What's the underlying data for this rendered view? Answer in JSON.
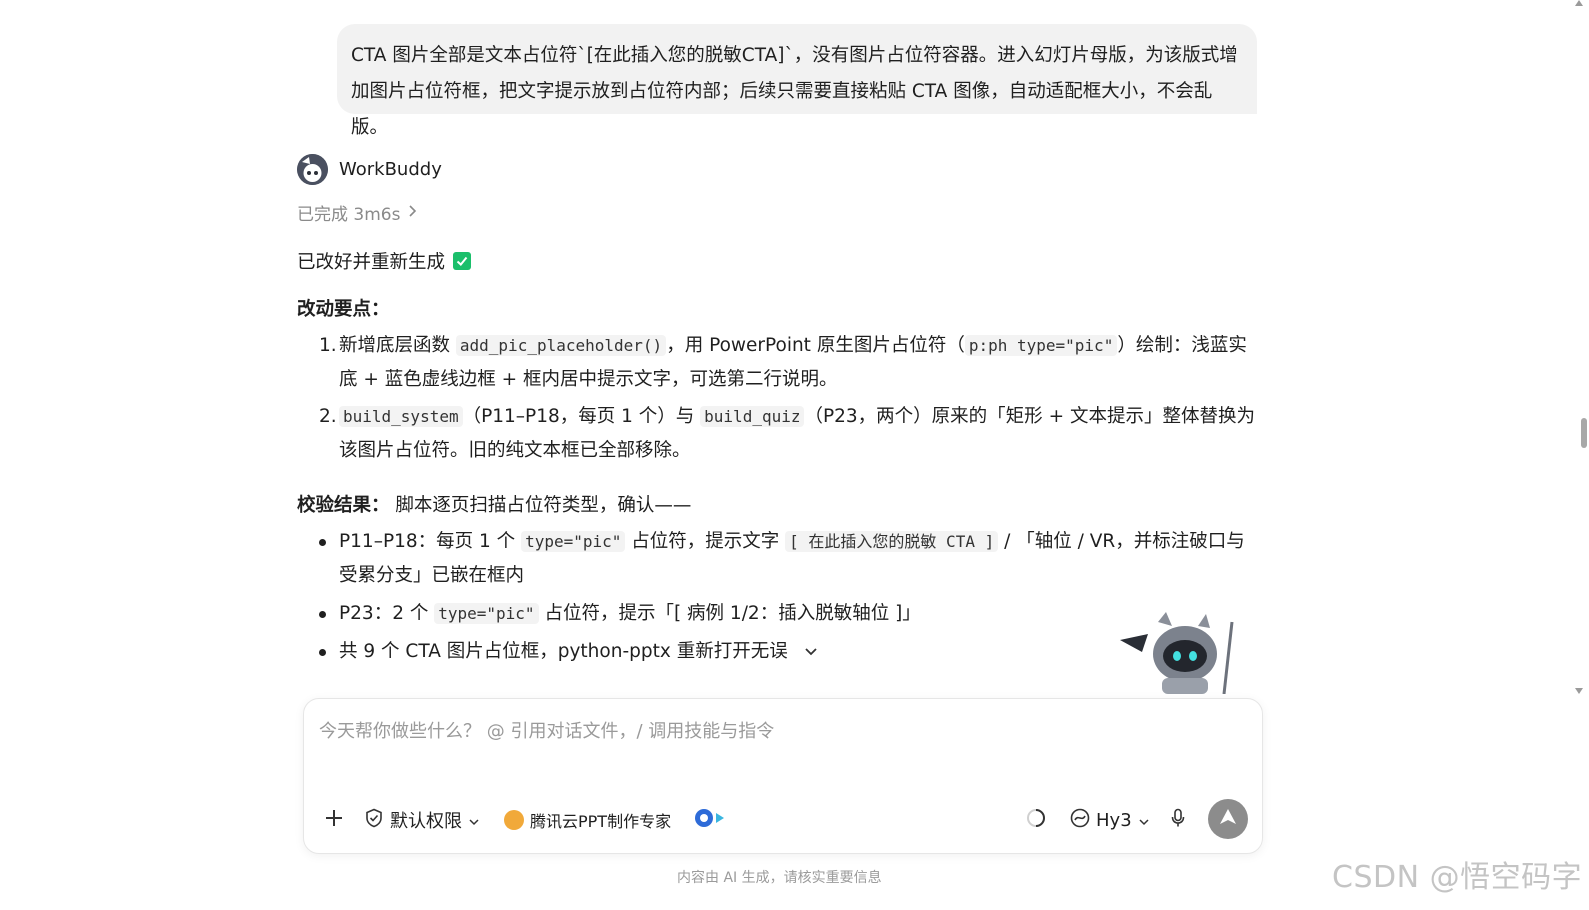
{
  "user_message": "CTA 图片全部是文本占位符`[在此插入您的脱敏CTA]`，没有图片占位符容器。进入幻灯片母版，为该版式增加图片占位符框，把文字提示放到占位符内部；后续只需要直接粘贴 CTA 图像，自动适配框大小，不会乱版。",
  "assistant": {
    "name": "WorkBuddy",
    "status": "已完成 3m6s",
    "done_text": "已改好并重新生成",
    "changes_title": "改动要点：",
    "changes": [
      {
        "number": "1.",
        "parts": [
          "新增底层函数 ",
          "add_pic_placeholder()",
          "，用 PowerPoint 原生图片占位符（",
          "p:ph type=\"pic\"",
          "）绘制：浅蓝实底 + 蓝色虚线边框 + 框内居中提示文字，可选第二行说明。"
        ]
      },
      {
        "number": "2.",
        "parts": [
          "build_system",
          "（P11–P18，每页 1 个）与 ",
          "build_quiz",
          "（P23，两个）原来的「矩形 + 文本提示」整体替换为该图片占位符。旧的纯文本框已全部移除。"
        ]
      }
    ],
    "verify_title": "校验结果：",
    "verify_intro": "脚本逐页扫描占位符类型，确认——",
    "verify_items": [
      {
        "parts": [
          "P11–P18：每页 1 个 ",
          "type=\"pic\"",
          " 占位符，提示文字 ",
          "[ 在此插入您的脱敏 CTA ]",
          " / 「轴位 / VR，并标注破口与受累分支」已嵌在框内"
        ]
      },
      {
        "parts": [
          "P23：2 个 ",
          "type=\"pic\"",
          " 占位符，提示「[ 病例 1/2：插入脱敏轴位 ]」"
        ]
      },
      {
        "parts": [
          "共 9 个 CTA 图片占位框，python-pptx 重新打开无误"
        ]
      }
    ]
  },
  "composer": {
    "placeholder": "今天帮你做些什么？ @ 引用对话文件，/ 调用技能与指令",
    "permission_label": "默认权限",
    "expert_label": "腾讯云PPT制作专家",
    "model_label": "Hy3"
  },
  "footer_note": "内容由 AI 生成，请核实重要信息",
  "watermark": "CSDN @悟空码字",
  "icons": {
    "plus": "plus-icon",
    "permission": "shield-check-icon",
    "chevron": "chevron-down-icon",
    "expert": "expert-avatar-icon",
    "agent": "agent-icon",
    "spinner": "loading-spinner-icon",
    "model": "model-logo-icon",
    "mic": "microphone-icon",
    "send": "send-arrow-icon",
    "status_chevron": "chevron-right-icon",
    "done_check": "checkbox-checked-icon"
  },
  "colors": {
    "user_bubble_bg": "#f2f2f2",
    "check_green": "#1bbf6b",
    "send_button": "#8c8c8c",
    "muted_text": "#8a8a8a"
  }
}
